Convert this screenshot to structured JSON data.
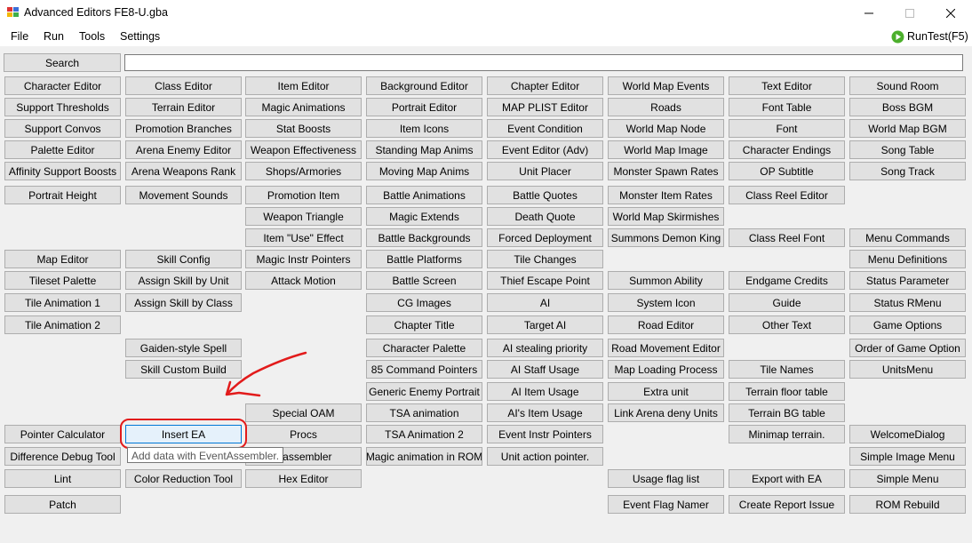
{
  "window": {
    "title": "Advanced Editors FE8-U.gba",
    "icon": "app-icon",
    "controls": [
      "minimize-icon",
      "maximize-icon",
      "close-icon"
    ]
  },
  "menu": {
    "items": [
      "File",
      "Run",
      "Tools",
      "Settings"
    ],
    "runtest_label": "RunTest(F5)",
    "runtest_icon": "play-icon",
    "runtest_color": "#4caf2c"
  },
  "search": {
    "button_label": "Search",
    "value": ""
  },
  "grid": [
    [
      "Character Editor",
      "Class Editor",
      "Item Editor",
      "Background Editor",
      "Chapter Editor",
      "World Map Events",
      "Text Editor",
      "Sound Room"
    ],
    [
      "Support Thresholds",
      "Terrain Editor",
      "Magic Animations",
      "Portrait Editor",
      "MAP PLIST Editor",
      "Roads",
      "Font Table",
      "Boss BGM"
    ],
    [
      "Support Convos",
      "Promotion Branches",
      "Stat Boosts",
      "Item Icons",
      "Event Condition",
      "World Map Node",
      "Font",
      "World Map BGM"
    ],
    [
      "Palette Editor",
      "Arena Enemy Editor",
      "Weapon Effectiveness",
      "Standing Map Anims",
      "Event Editor (Adv)",
      "World Map Image",
      "Character Endings",
      "Song Table"
    ],
    [
      "Affinity Support Boosts",
      "Arena Weapons Rank",
      "Shops/Armories",
      "Moving Map Anims",
      "Unit Placer",
      "Monster Spawn Rates",
      "OP Subtitle",
      "Song Track"
    ],
    [
      "Portrait Height",
      "Movement Sounds",
      "Promotion Item",
      "Battle Animations",
      "Battle Quotes",
      "Monster Item Rates",
      "Class Reel Editor",
      ""
    ],
    [
      "",
      "",
      "Weapon Triangle",
      "Magic Extends",
      "Death Quote",
      "World Map Skirmishes",
      "",
      ""
    ],
    [
      "",
      "",
      "Item \"Use\" Effect",
      "Battle Backgrounds",
      "Forced Deployment",
      "Summons Demon King",
      "Class Reel Font",
      "Menu Commands"
    ],
    [
      "Map Editor",
      "Skill Config",
      "Magic Instr Pointers",
      "Battle Platforms",
      "Tile Changes",
      "",
      "",
      "Menu Definitions"
    ],
    [
      "Tileset Palette",
      "Assign Skill by Unit",
      "Attack Motion",
      "Battle Screen",
      "Thief Escape Point",
      "Summon Ability",
      "Endgame Credits",
      "Status Parameter"
    ],
    [
      "Tile Animation 1",
      "Assign Skill by Class",
      "",
      "CG Images",
      "AI",
      "System Icon",
      "Guide",
      "Status RMenu"
    ],
    [
      "Tile Animation 2",
      "",
      "",
      "Chapter Title",
      "Target AI",
      "Road Editor",
      "Other Text",
      "Game Options"
    ],
    [
      "",
      "Gaiden-style Spell",
      "",
      "Character Palette",
      "AI stealing priority",
      "Road Movement Editor",
      "",
      "Order of Game Option"
    ],
    [
      "",
      "Skill Custom Build",
      "",
      "85 Command Pointers",
      "AI Staff Usage",
      "Map Loading Process",
      "Tile Names",
      "UnitsMenu"
    ],
    [
      "",
      "",
      "",
      "Generic Enemy Portrait",
      "AI Item Usage",
      "Extra unit",
      "Terrain floor table",
      ""
    ],
    [
      "",
      "",
      "Special OAM",
      "TSA animation",
      "AI's Item Usage",
      "Link Arena deny Units",
      "Terrain BG table",
      ""
    ],
    [
      "Pointer Calculator",
      "Insert EA",
      "Procs",
      "TSA Animation 2",
      "Event Instr Pointers",
      "",
      "Minimap terrain.",
      "WelcomeDialog"
    ],
    [
      "Difference Debug Tool",
      "",
      "isassembler",
      "Magic animation in ROM",
      "Unit action pointer.",
      "",
      "",
      "Simple Image Menu"
    ],
    [
      "Lint",
      "Color Reduction Tool",
      "Hex Editor",
      "",
      "",
      "Usage flag list",
      "Export with EA",
      "Simple Menu"
    ],
    [
      "Patch",
      "",
      "",
      "",
      "",
      "Event Flag Namer",
      "Create Report Issue",
      "ROM Rebuild"
    ]
  ],
  "tooltip": {
    "text": "Add data with EventAssembler."
  },
  "annotation_color": "#e21b1b"
}
